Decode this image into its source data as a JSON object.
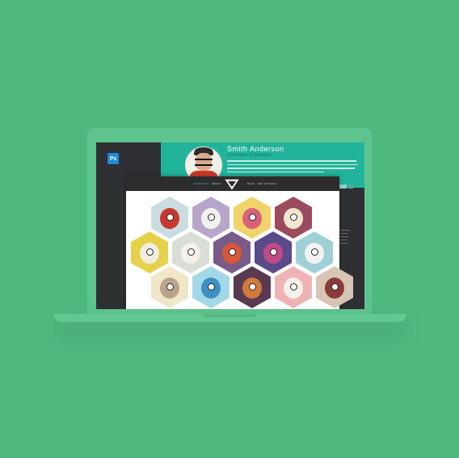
{
  "photoshop": {
    "badge_label": "Ps"
  },
  "profile": {
    "name": "Smith Anderson",
    "role": "UI Designer & Developer"
  },
  "portfolio_nav": {
    "items": [
      {
        "label": "PORTFOLIO",
        "active": true
      },
      {
        "label": "ABOUT",
        "active": false
      },
      {
        "label": "BLOG",
        "active": false
      },
      {
        "label": "GET IN TOUCH",
        "active": false
      }
    ]
  },
  "colors": {
    "background": "#4fb87f",
    "header_teal": "#22b49a",
    "nav_dark": "#2d2d2f",
    "accent": "#2fc1a8"
  },
  "gallery": {
    "tiles": [
      {
        "icon": "red-monster-icon",
        "bg": "#c9dde0",
        "fg": "#c9382e"
      },
      {
        "icon": "purple-creature-icon",
        "bg": "#b7a6c9",
        "fg": "#f1f1ee"
      },
      {
        "icon": "yellow-horned-monster-icon",
        "bg": "#f0d36a",
        "fg": "#d9627a"
      },
      {
        "icon": "skeleton-creature-icon",
        "bg": "#9c4a5e",
        "fg": "#f3e6ce"
      },
      {
        "icon": "yellow-yeti-icon",
        "bg": "#e5d14a",
        "fg": "#f2ece0"
      },
      {
        "icon": "white-sheep-icon",
        "bg": "#d8ddd6",
        "fg": "#f4f1ea"
      },
      {
        "icon": "rocket-creature-icon",
        "bg": "#7a5a86",
        "fg": "#d8583a"
      },
      {
        "icon": "purple-beast-icon",
        "bg": "#5a4a8a",
        "fg": "#c04a86"
      },
      {
        "icon": "snowmen-icon",
        "bg": "#9fd0d6",
        "fg": "#f2f2f2"
      },
      {
        "icon": "ghost-creature-icon",
        "bg": "#efe7c8",
        "fg": "#bba48a"
      },
      {
        "icon": "jellyfish-icon",
        "bg": "#a3d9e6",
        "fg": "#3e8fc2"
      },
      {
        "icon": "tribal-mask-icon",
        "bg": "#5a3a52",
        "fg": "#d27a3a"
      },
      {
        "icon": "pink-creature-icon",
        "bg": "#f0b3b5",
        "fg": "#f4f0ea"
      },
      {
        "icon": "horned-viking-icon",
        "bg": "#d7c6b4",
        "fg": "#8a3a3a"
      }
    ]
  }
}
